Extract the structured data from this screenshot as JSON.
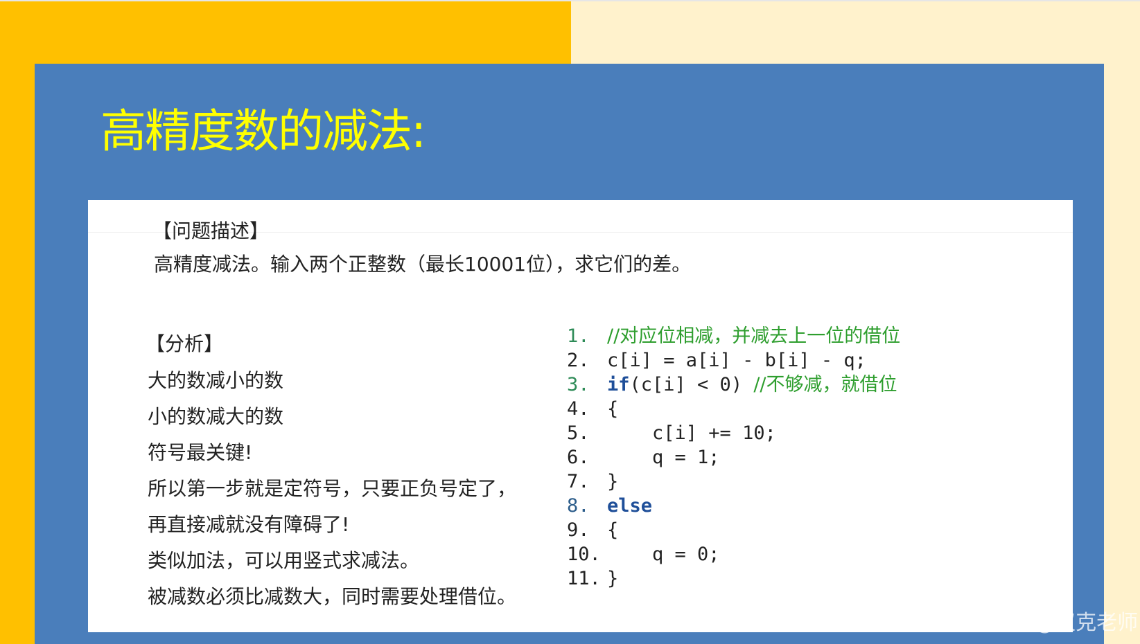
{
  "slide": {
    "title": "高精度数的减法:"
  },
  "problem": {
    "heading": "【问题描述】",
    "text": "高精度减法。输入两个正整数（最长10001位），求它们的差。"
  },
  "analysis": {
    "heading": "【分析】",
    "lines": [
      "大的数减小的数",
      "小的数减大的数",
      "符号最关键!",
      "所以第一步就是定符号，只要正负号定了，",
      "再直接减就没有障碍了!",
      "类似加法，可以用竖式求减法。",
      "被减数必须比减数大，同时需要处理借位。"
    ]
  },
  "code": {
    "lines": [
      {
        "num": "1.",
        "parts": [
          {
            "t": "//对应位相减，并减去上一位的借位",
            "cls": "cmt"
          }
        ]
      },
      {
        "num": "2.",
        "parts": [
          {
            "t": "c[i] = a[i] - b[i] - q;",
            "cls": ""
          }
        ]
      },
      {
        "num": "3.",
        "parts": [
          {
            "t": "if",
            "cls": "kw"
          },
          {
            "t": "(c[i] < 0) ",
            "cls": ""
          },
          {
            "t": "//不够减，就借位",
            "cls": "cmt"
          }
        ]
      },
      {
        "num": "4.",
        "parts": [
          {
            "t": "{",
            "cls": ""
          }
        ]
      },
      {
        "num": "5.",
        "parts": [
          {
            "t": "    c[i] += 10;",
            "cls": ""
          }
        ]
      },
      {
        "num": "6.",
        "parts": [
          {
            "t": "    q = 1;",
            "cls": ""
          }
        ]
      },
      {
        "num": "7.",
        "parts": [
          {
            "t": "}",
            "cls": ""
          }
        ]
      },
      {
        "num": "8.",
        "parts": [
          {
            "t": "else",
            "cls": "kw"
          }
        ]
      },
      {
        "num": "9.",
        "parts": [
          {
            "t": "{",
            "cls": ""
          }
        ]
      },
      {
        "num": "10.",
        "parts": [
          {
            "t": "    q = 0;",
            "cls": ""
          }
        ]
      },
      {
        "num": "11.",
        "parts": [
          {
            "t": "}",
            "cls": ""
          }
        ]
      }
    ]
  },
  "watermark": "CSDN @汉克老师",
  "colors": {
    "background_left": "#ffc000",
    "background_right": "#fff2cc",
    "panel": "#4a7ebb",
    "title": "#ffff00",
    "comment": "#2e9e2e",
    "keyword": "#1f4f99"
  }
}
